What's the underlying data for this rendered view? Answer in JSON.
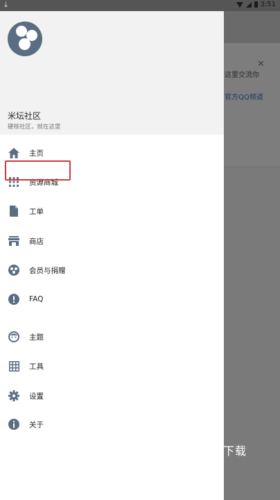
{
  "status_bar": {
    "time": "3:51",
    "download_icon": "download-icon"
  },
  "background_app": {
    "card_text_line1": "这里交流你",
    "card_text_line2": "官方QQ频道",
    "overlay_text": "下载"
  },
  "drawer": {
    "header": {
      "title": "米坛社区",
      "subtitle": "硬核社区，就在这里"
    },
    "menu": [
      {
        "label": "主页",
        "icon": "home-icon"
      },
      {
        "label": "资源商城",
        "icon": "grid-apps-icon"
      },
      {
        "label": "工单",
        "icon": "document-icon"
      },
      {
        "label": "商店",
        "icon": "store-icon"
      },
      {
        "label": "会员与捐赠",
        "icon": "donate-icon"
      },
      {
        "label": "FAQ",
        "icon": "info-exclamation-icon"
      },
      {
        "label": "主题",
        "icon": "face-icon"
      },
      {
        "label": "工具",
        "icon": "table-grid-icon"
      },
      {
        "label": "设置",
        "icon": "gear-icon"
      },
      {
        "label": "关于",
        "icon": "info-icon"
      }
    ]
  },
  "colors": {
    "icon": "#5b6d82",
    "highlight": "#d23a3a"
  }
}
